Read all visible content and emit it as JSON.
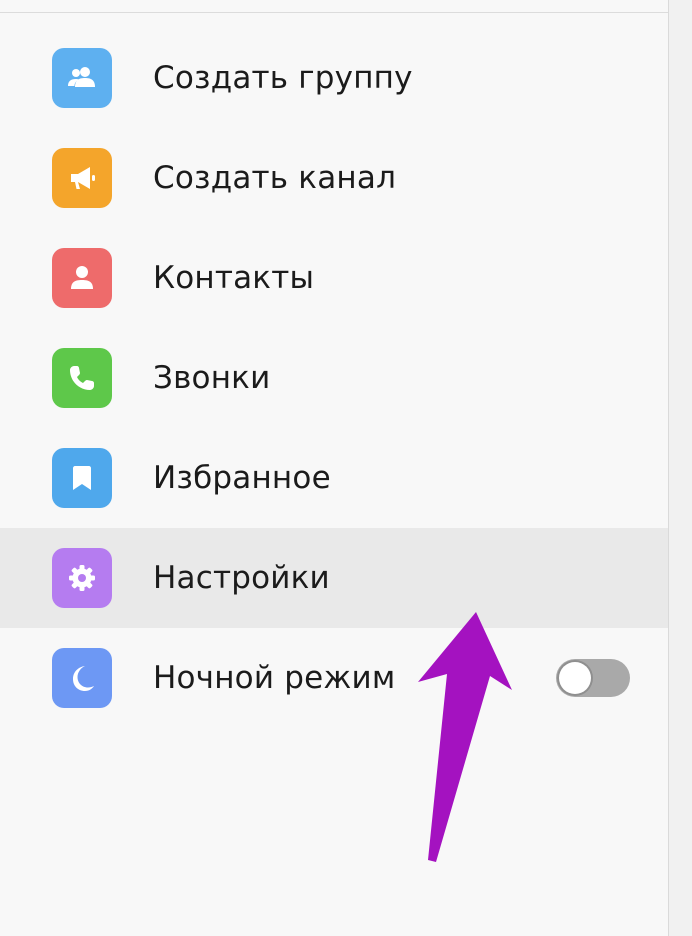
{
  "menu": {
    "items": [
      {
        "label": "Создать группу",
        "icon": "group-icon",
        "color": "#5eb0f0"
      },
      {
        "label": "Создать канал",
        "icon": "megaphone-icon",
        "color": "#f4a52b"
      },
      {
        "label": "Контакты",
        "icon": "person-icon",
        "color": "#ee6b6b"
      },
      {
        "label": "Звонки",
        "icon": "phone-icon",
        "color": "#5ec84a"
      },
      {
        "label": "Избранное",
        "icon": "bookmark-icon",
        "color": "#4fa8ec"
      },
      {
        "label": "Настройки",
        "icon": "gear-icon",
        "color": "#b57cf0",
        "active": true
      },
      {
        "label": "Ночной режим",
        "icon": "moon-icon",
        "color": "#6d98f4"
      }
    ],
    "night_mode_toggle": {
      "on": false
    }
  },
  "annotation": {
    "arrow_color": "#a412c0",
    "points_to": "Настройки"
  }
}
